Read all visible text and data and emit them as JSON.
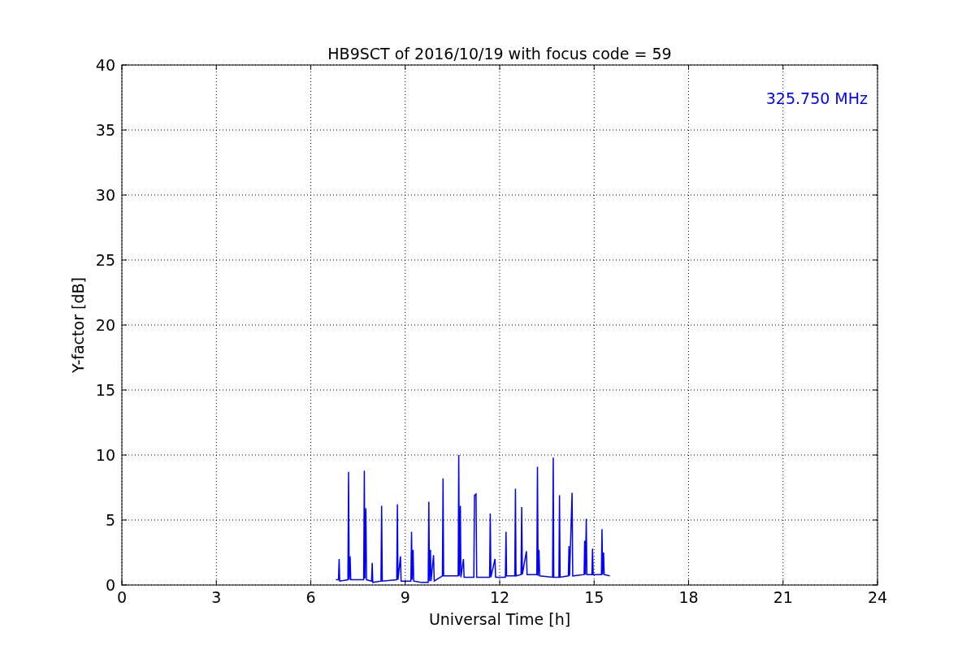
{
  "chart_data": {
    "type": "line",
    "title": "HB9SCT of 2016/10/19 with focus code = 59",
    "xlabel": "Universal Time [h]",
    "ylabel": "Y-factor [dB]",
    "x": [
      6.8,
      6.88,
      6.9,
      6.92,
      7.18,
      7.2,
      7.22,
      7.25,
      7.27,
      7.68,
      7.7,
      7.72,
      7.75,
      7.77,
      7.93,
      7.95,
      7.97,
      8.23,
      8.25,
      8.27,
      8.73,
      8.75,
      8.77,
      8.85,
      8.87,
      9.18,
      9.2,
      9.22,
      9.25,
      9.27,
      9.5,
      9.73,
      9.75,
      9.77,
      9.8,
      9.82,
      9.9,
      9.92,
      10.18,
      10.2,
      10.22,
      10.68,
      10.7,
      10.72,
      10.75,
      10.77,
      10.85,
      10.87,
      11.18,
      11.2,
      11.25,
      11.27,
      11.68,
      11.7,
      11.72,
      11.85,
      11.87,
      12.18,
      12.2,
      12.22,
      12.48,
      12.5,
      12.52,
      12.68,
      12.7,
      12.72,
      12.85,
      12.87,
      13.18,
      13.2,
      13.22,
      13.25,
      13.27,
      13.68,
      13.7,
      13.72,
      13.88,
      13.9,
      13.92,
      14.18,
      14.2,
      14.22,
      14.3,
      14.32,
      14.68,
      14.7,
      14.72,
      14.75,
      14.77,
      14.93,
      14.95,
      14.97,
      15.23,
      15.25,
      15.27,
      15.3,
      15.32,
      15.5
    ],
    "series": [
      {
        "name": "325.750 MHz",
        "color": "#0000ff",
        "values": [
          0.4,
          0.4,
          2.0,
          0.3,
          0.4,
          8.7,
          0.4,
          2.2,
          0.4,
          0.4,
          8.8,
          0.5,
          5.9,
          0.4,
          0.3,
          1.7,
          0.2,
          0.3,
          6.1,
          0.3,
          0.4,
          6.2,
          0.4,
          2.2,
          0.3,
          0.3,
          4.1,
          0.4,
          2.7,
          0.3,
          0.2,
          0.2,
          6.4,
          0.3,
          2.7,
          0.3,
          2.3,
          0.3,
          0.7,
          8.2,
          0.7,
          0.7,
          10.0,
          0.7,
          6.1,
          0.6,
          2.0,
          0.6,
          0.6,
          6.9,
          7.0,
          0.6,
          0.6,
          5.5,
          0.6,
          2.0,
          0.6,
          0.6,
          4.1,
          0.7,
          0.7,
          7.4,
          0.7,
          0.8,
          6.0,
          0.8,
          2.6,
          0.8,
          0.8,
          9.1,
          0.7,
          2.7,
          0.7,
          0.6,
          9.8,
          0.6,
          0.6,
          6.9,
          0.6,
          0.7,
          3.0,
          0.7,
          7.1,
          0.7,
          0.8,
          3.4,
          0.8,
          5.1,
          0.8,
          0.8,
          2.8,
          0.8,
          0.8,
          4.3,
          0.8,
          2.5,
          0.8,
          0.7
        ]
      }
    ],
    "xlim": [
      0,
      24
    ],
    "ylim": [
      0,
      40
    ],
    "xticks": [
      0,
      3,
      6,
      9,
      12,
      15,
      18,
      21,
      24
    ],
    "yticks": [
      0,
      5,
      10,
      15,
      20,
      25,
      30,
      35,
      40
    ],
    "grid": true
  }
}
